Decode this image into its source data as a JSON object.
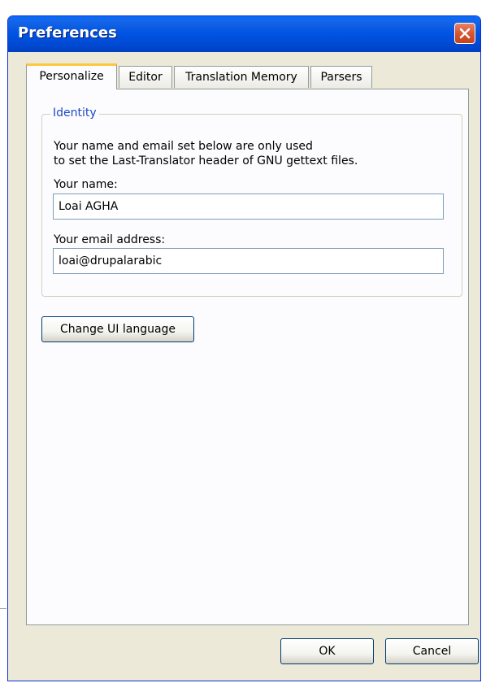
{
  "window": {
    "title": "Preferences"
  },
  "tabs": [
    {
      "label": "Personalize",
      "active": true
    },
    {
      "label": "Editor",
      "active": false
    },
    {
      "label": "Translation Memory",
      "active": false
    },
    {
      "label": "Parsers",
      "active": false
    }
  ],
  "identity": {
    "title": "Identity",
    "description_line1": "Your name and email set below are only used",
    "description_line2": "to set the Last-Translator header of GNU gettext files.",
    "name_label": "Your name:",
    "name_value": "Loai AGHA",
    "email_label": "Your email address:",
    "email_value": "loai@drupalarabic"
  },
  "buttons": {
    "change_ui_language": "Change UI language",
    "ok": "OK",
    "cancel": "Cancel"
  },
  "colors": {
    "titlebar": "#0054e3",
    "window_face": "#ece9d8",
    "active_tab_highlight": "#ffc83c",
    "group_title": "#1f49c4",
    "close_button": "#d9562f"
  }
}
